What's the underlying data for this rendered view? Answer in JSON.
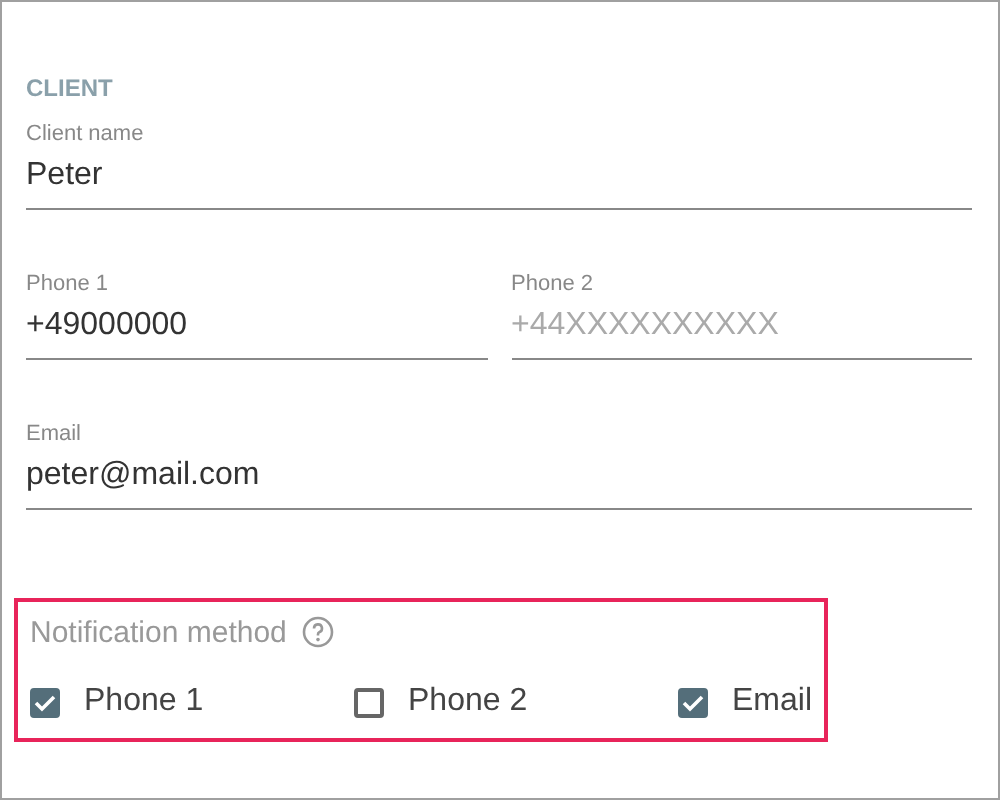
{
  "section_title": "CLIENT",
  "field_rows": [
    [
      {
        "label": "Client name",
        "value": "Peter"
      }
    ],
    [
      {
        "label": "Phone 1",
        "value": "+49000000"
      },
      {
        "label": "Phone 2",
        "placeholder": "+44XXXXXXXXXX"
      }
    ],
    [
      {
        "label": "Email",
        "value": "peter@mail.com"
      }
    ]
  ],
  "notification": {
    "label": "Notification method",
    "options": [
      {
        "label": "Phone 1",
        "checked": true
      },
      {
        "label": "Phone 2",
        "checked": false
      },
      {
        "label": "Email",
        "checked": true
      }
    ]
  }
}
